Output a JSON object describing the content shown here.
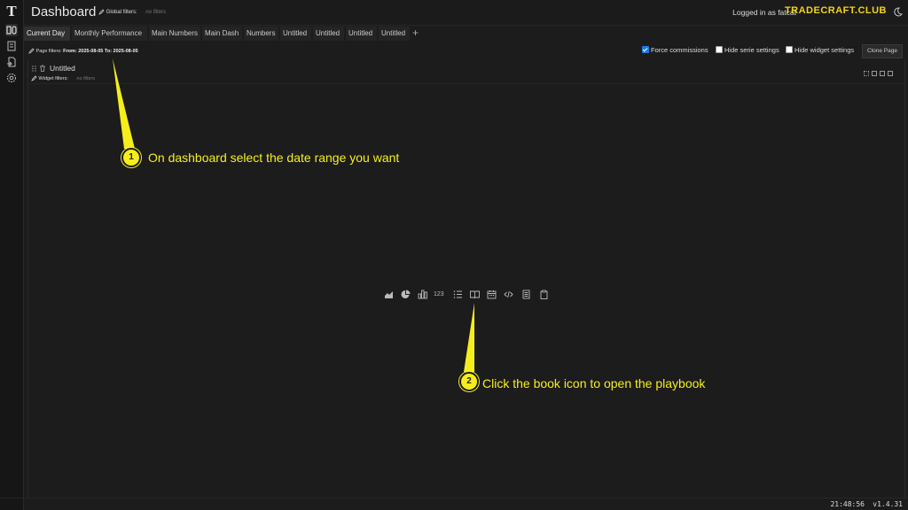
{
  "header": {
    "title": "Dashboard",
    "global_filters_label": "Global filters:",
    "global_filters_value": "no filters",
    "logged_in_text": "Logged in as fatcat",
    "brand": "TRADECRAFT.CLUB"
  },
  "tabs": [
    {
      "label": "Current Day",
      "active": true
    },
    {
      "label": "Monthly Performance"
    },
    {
      "label": "Main Numbers"
    },
    {
      "label": "Main Dash"
    },
    {
      "label": "Numbers"
    },
    {
      "label": "Untitled"
    },
    {
      "label": "Untitled"
    },
    {
      "label": "Untitled"
    },
    {
      "label": "Untitled"
    }
  ],
  "tab_add": "+",
  "page_filters": {
    "label": "Page filters:",
    "value": "From: 2025-08-05 To: 2025-08-05"
  },
  "options": {
    "force_commissions": "Force commissions",
    "hide_serie_settings": "Hide serie settings",
    "hide_widget_settings": "Hide widget settings",
    "clone_page": "Clone Page"
  },
  "widget": {
    "title": "Untitled",
    "filters_label": "Widget filters:",
    "filters_value": "no filters",
    "numbers_icon_text": "123"
  },
  "annotations": {
    "one_number": "1",
    "one_text": "On dashboard select the date range you want",
    "two_number": "2",
    "two_text": "Click the book icon to open the playbook",
    "color": "#f5ee1c"
  },
  "status": {
    "time": "21:48:56",
    "version": "v1.4.31"
  },
  "icons": [
    "logo-icon",
    "dashboard-icon",
    "journal-icon",
    "import-icon",
    "settings-icon",
    "pencil-icon",
    "moon-icon",
    "drag-handle-icon",
    "trash-icon",
    "area-chart-icon",
    "pie-chart-icon",
    "bar-chart-icon",
    "numbers-icon",
    "list-icon",
    "book-icon",
    "calendar-icon",
    "code-icon",
    "document-icon",
    "clipboard-icon"
  ]
}
